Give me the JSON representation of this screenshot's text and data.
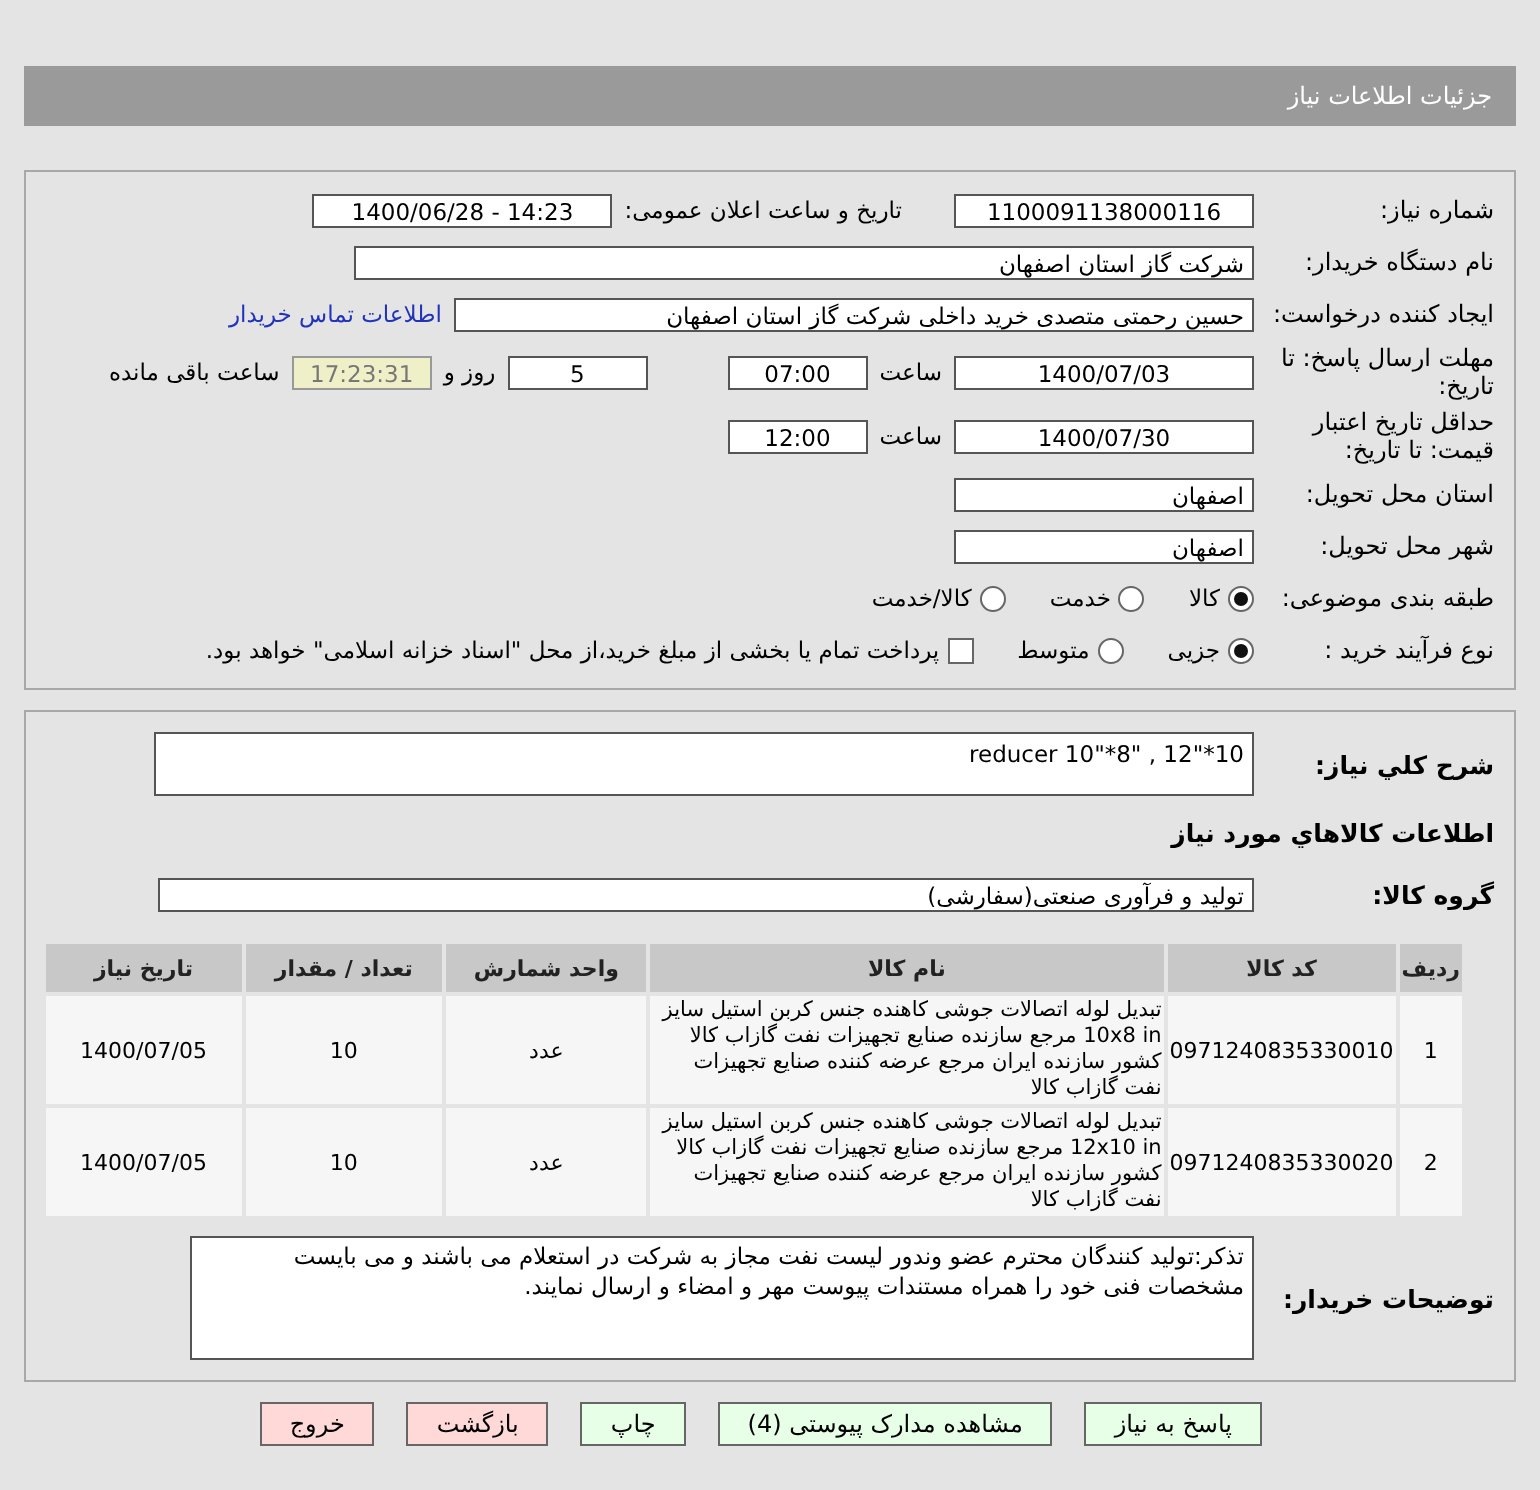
{
  "header": {
    "title": "جزئیات اطلاعات نیاز"
  },
  "need_number": {
    "label": "شماره نیاز:",
    "value": "1100091138000116"
  },
  "announce": {
    "label": "تاریخ و ساعت اعلان عمومی:",
    "value": "1400/06/28 - 14:23"
  },
  "buyer": {
    "label": "نام دستگاه خریدار:",
    "value": "شرکت گاز استان اصفهان"
  },
  "requester": {
    "label": "ایجاد کننده درخواست:",
    "value": "حسین  رحمتی متصدی خرید داخلی شرکت گاز استان اصفهان",
    "link": "اطلاعات تماس خریدار"
  },
  "deadline": {
    "label": "مهلت ارسال پاسخ: تا تاریخ:",
    "date": "1400/07/03",
    "time_label": "ساعت",
    "time": "07:00",
    "days": "5",
    "days_label": "روز و",
    "remaining": "17:23:31",
    "remaining_label": "ساعت باقی مانده"
  },
  "validity": {
    "label": "حداقل تاریخ اعتبار قیمت: تا تاریخ:",
    "date": "1400/07/30",
    "time_label": "ساعت",
    "time": "12:00"
  },
  "province": {
    "label": "استان محل تحویل:",
    "value": "اصفهان"
  },
  "city": {
    "label": "شهر محل تحویل:",
    "value": "اصفهان"
  },
  "category": {
    "label": "طبقه بندی موضوعی:",
    "options": [
      {
        "label": "کالا",
        "selected": true
      },
      {
        "label": "خدمت",
        "selected": false
      },
      {
        "label": "کالا/خدمت",
        "selected": false
      }
    ]
  },
  "process": {
    "label": "نوع فرآیند خرید :",
    "options": [
      {
        "label": "جزیی",
        "selected": true
      },
      {
        "label": "متوسط",
        "selected": false
      }
    ],
    "payment": {
      "checked": false,
      "label": "پرداخت تمام یا بخشی از مبلغ خرید،از محل \"اسناد خزانه اسلامی\" خواهد بود."
    }
  },
  "description": {
    "label": "شرح کلي نياز:",
    "value": "reducer 10\"*8\" , 12\"*10"
  },
  "goods_heading": "اطلاعات کالاهاي مورد نياز",
  "goods_group": {
    "label": "گروه کالا:",
    "value": "تولید و فرآوری صنعتی(سفارشی)"
  },
  "table": {
    "columns": [
      "ردیف",
      "کد کالا",
      "نام کالا",
      "واحد شمارش",
      "تعداد / مقدار",
      "تاریخ نیاز"
    ],
    "rows": [
      [
        "1",
        "0971240835330010",
        "تبدیل لوله اتصالات جوشی کاهنده جنس کربن استیل سایز 10x8 in مرجع سازنده صنایع تجهیزات نفت گازاب کالا کشور سازنده ایران مرجع عرضه کننده صنایع تجهیزات نفت گازاب کالا",
        "عدد",
        "10",
        "1400/07/05"
      ],
      [
        "2",
        "0971240835330020",
        "تبدیل لوله اتصالات جوشی کاهنده جنس کربن استیل سایز 12x10 in مرجع سازنده صنایع تجهیزات نفت گازاب کالا کشور سازنده ایران مرجع عرضه کننده صنایع تجهیزات نفت گازاب کالا",
        "عدد",
        "10",
        "1400/07/05"
      ]
    ]
  },
  "notes": {
    "label": "توضیحات خریدار:",
    "value": "تذکر:تولید کنندگان محترم عضو وندور لیست نفت مجاز به شرکت در استعلام می باشند و می بایست مشخصات فنی خود را همراه مستندات پیوست مهر و امضاء و ارسال نمایند."
  },
  "buttons": [
    {
      "label": "پاسخ به نیاز",
      "kind": "primary"
    },
    {
      "label": "مشاهده مدارک پیوستی (4)",
      "kind": "primary"
    },
    {
      "label": "چاپ",
      "kind": "primary"
    },
    {
      "label": "بازگشت",
      "kind": "danger"
    },
    {
      "label": "خروج",
      "kind": "danger"
    }
  ]
}
